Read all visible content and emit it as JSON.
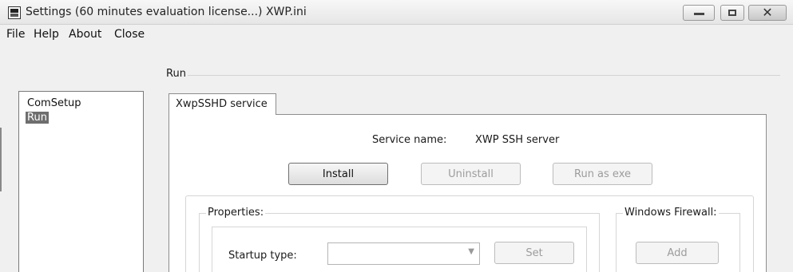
{
  "window": {
    "title": "Settings (60 minutes evaluation license...) XWP.ini",
    "controls": {
      "close_glyph": "✕"
    }
  },
  "menu": {
    "items": [
      "File",
      "Help",
      "About",
      "Close"
    ]
  },
  "sidebar": {
    "items": [
      {
        "label": "ComSetup",
        "selected": false
      },
      {
        "label": "Run",
        "selected": true
      }
    ]
  },
  "run_group": {
    "label": "Run"
  },
  "tabs": [
    {
      "label": "XwpSSHD service",
      "active": true
    }
  ],
  "service": {
    "name_label": "Service name:",
    "name_value": "XWP SSH server",
    "buttons": {
      "install": "Install",
      "uninstall": "Uninstall",
      "run_as_exe": "Run as exe"
    }
  },
  "properties": {
    "label": "Properties:",
    "startup_type_label": "Startup type:",
    "startup_type_value": "",
    "set_button": "Set"
  },
  "firewall": {
    "label": "Windows Firewall:",
    "add_button": "Add"
  },
  "icons": {
    "app": "app-icon",
    "minimize": "minimize-icon",
    "maximize": "maximize-icon",
    "close": "close-icon",
    "dropdown": "chevron-down-icon"
  }
}
